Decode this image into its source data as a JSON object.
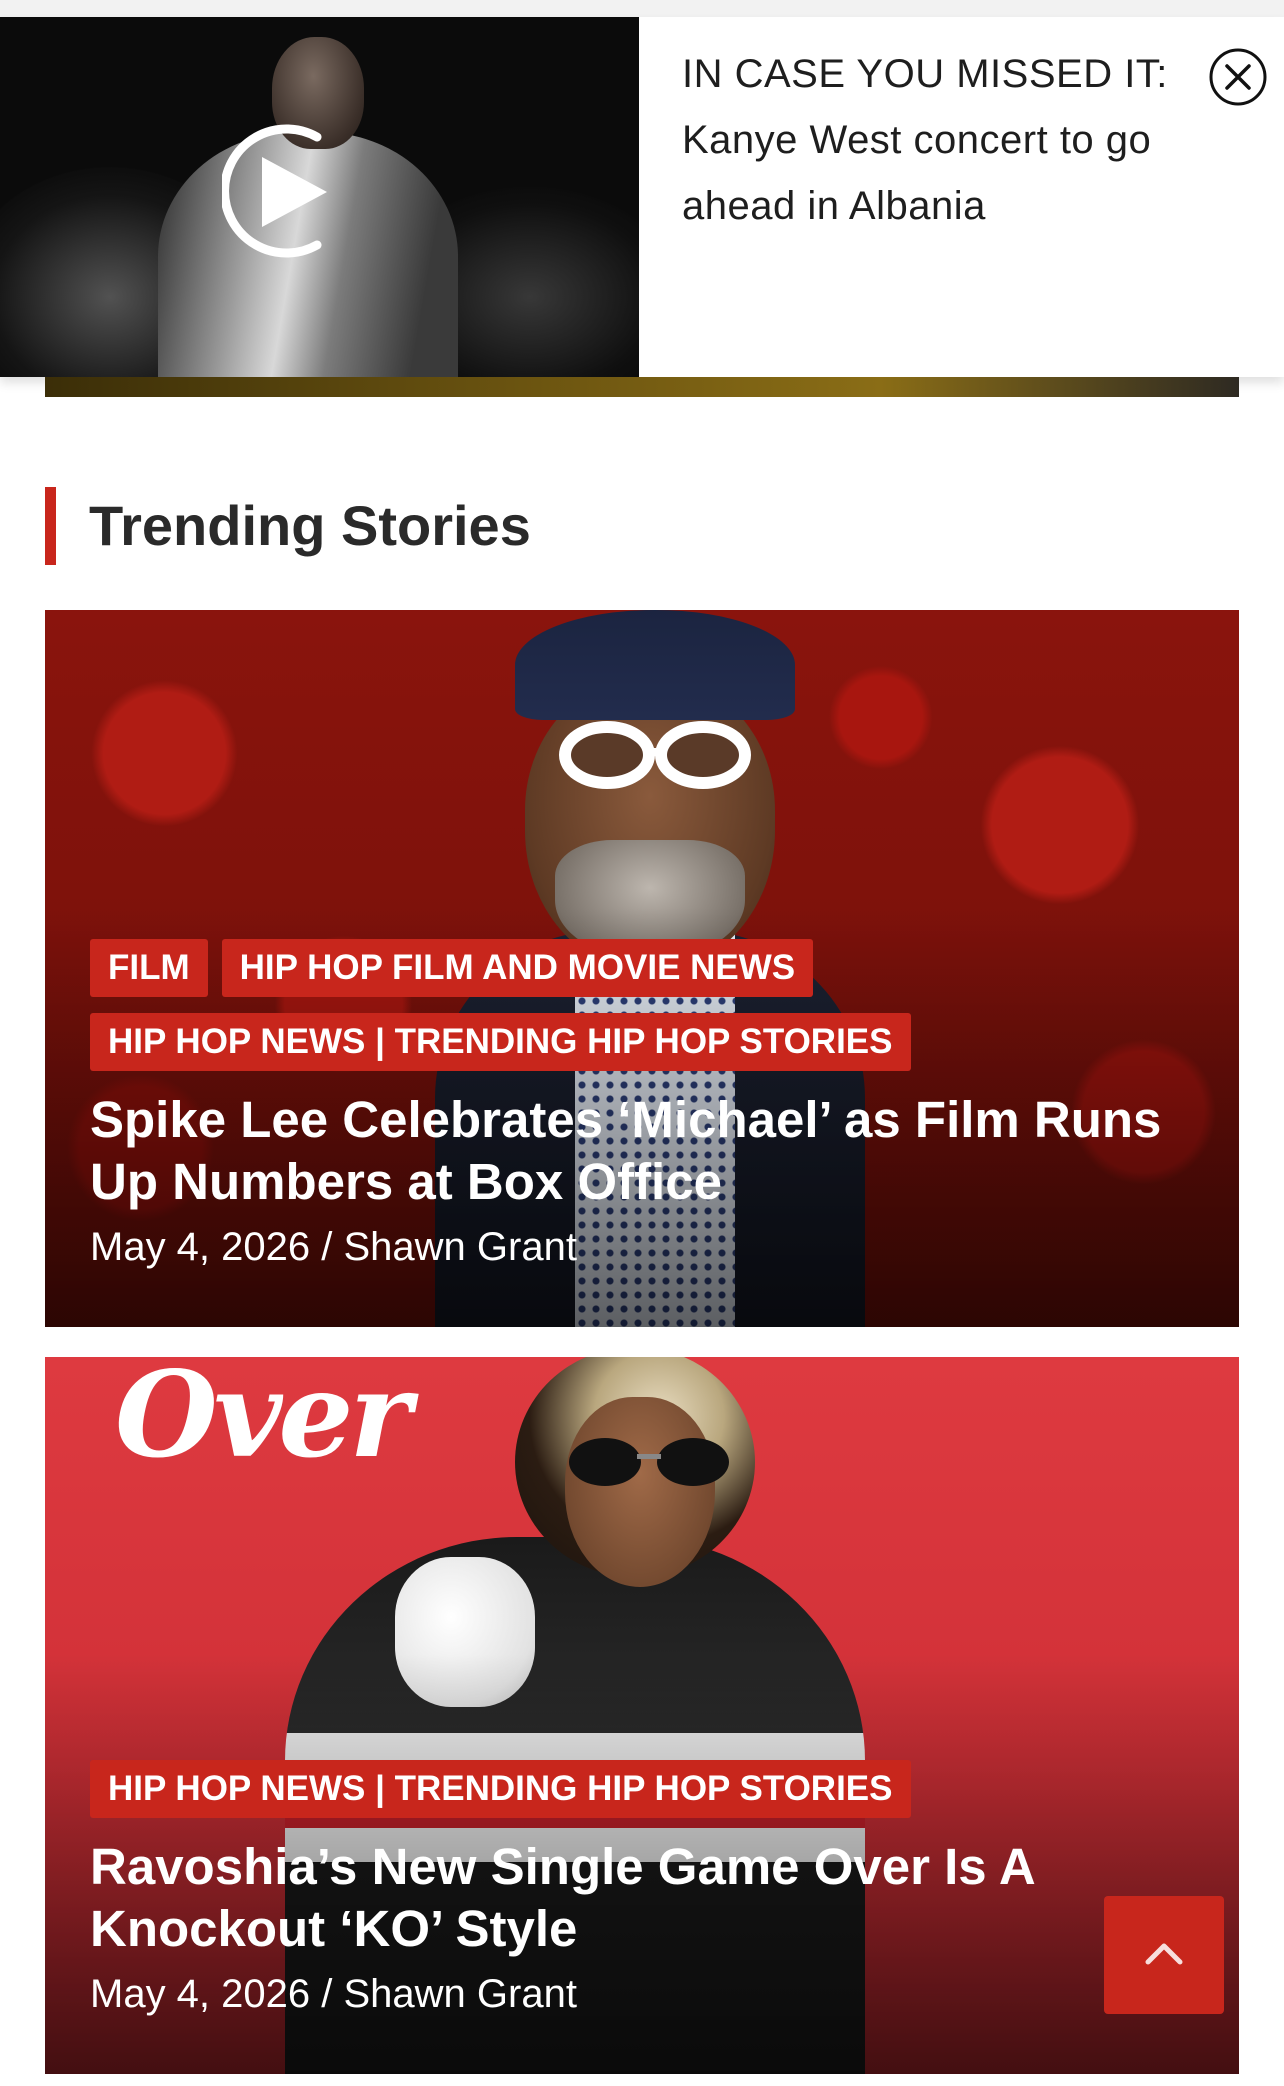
{
  "video_popup": {
    "headline": "IN CASE YOU MISSED IT: Kanye West concert to go ahead in Albania",
    "close_icon": "close-circle-icon",
    "play_icon": "play-icon"
  },
  "section": {
    "title": "Trending Stories"
  },
  "stories": [
    {
      "tags": [
        "FILM",
        "HIP HOP FILM AND MOVIE NEWS",
        "HIP HOP NEWS | TRENDING HIP HOP STORIES"
      ],
      "title": "Spike Lee Celebrates ‘Michael’ as Film Runs Up Numbers at Box Office",
      "byline": "May 4, 2026 / Shawn Grant"
    },
    {
      "image_text": "Over",
      "tags": [
        "HIP HOP NEWS | TRENDING HIP HOP STORIES"
      ],
      "title": "Ravoshia’s New Single Game Over Is A Knockout ‘KO’ Style",
      "byline": "May 4, 2026 / Shawn Grant"
    }
  ],
  "back_to_top": {
    "icon": "chevron-up-icon"
  },
  "colors": {
    "accent": "#c8261c",
    "text_dark": "#2a2a2a"
  }
}
